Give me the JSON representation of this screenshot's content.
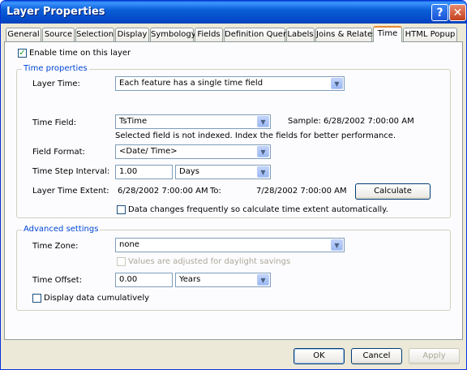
{
  "window": {
    "title": "Layer Properties",
    "help_label": "?",
    "close_label": "✕"
  },
  "tabs": [
    {
      "label": "General"
    },
    {
      "label": "Source"
    },
    {
      "label": "Selection"
    },
    {
      "label": "Display"
    },
    {
      "label": "Symbology"
    },
    {
      "label": "Fields"
    },
    {
      "label": "Definition Query"
    },
    {
      "label": "Labels"
    },
    {
      "label": "Joins & Relates"
    },
    {
      "label": "Time"
    },
    {
      "label": "HTML Popup"
    }
  ],
  "active_tab": "Time",
  "enable_time": {
    "label": "Enable time on this layer",
    "checked": true
  },
  "time_properties": {
    "group_label": "Time properties",
    "layer_time_label": "Layer Time:",
    "layer_time_value": "Each feature has a single time field",
    "time_field_label": "Time Field:",
    "time_field_value": "TsTime",
    "sample_text": "Sample: 6/28/2002 7:00:00 AM",
    "index_warning": "Selected field is not indexed. Index the fields for better performance.",
    "field_format_label": "Field Format:",
    "field_format_value": "<Date/ Time>",
    "step_label": "Time Step Interval:",
    "step_value": "1.00",
    "step_unit": "Days",
    "extent_label": "Layer Time Extent:",
    "extent_from": "6/28/2002 7:00:00 AM",
    "extent_to_label": "To:",
    "extent_to": "7/28/2002 7:00:00 AM",
    "calculate_label": "Calculate",
    "auto_calc_label": "Data changes frequently so calculate time extent automatically.",
    "auto_calc_checked": false
  },
  "advanced": {
    "group_label": "Advanced settings",
    "zone_label": "Time Zone:",
    "zone_value": "none",
    "daylight_label": "Values are adjusted for daylight savings",
    "offset_label": "Time Offset:",
    "offset_value": "0.00",
    "offset_unit": "Years",
    "cumulative_label": "Display data cumulatively",
    "cumulative_checked": false
  },
  "buttons": {
    "ok": "OK",
    "cancel": "Cancel",
    "apply": "Apply"
  },
  "colors": {
    "title_bar": "#0a5fd8",
    "group_label": "#0046d5",
    "active_tab_accent": "#e68b2c"
  }
}
